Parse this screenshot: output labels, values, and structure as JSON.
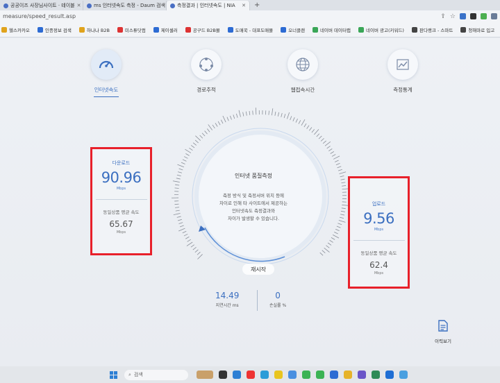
{
  "browser": {
    "tabs": [
      {
        "title": "공공이즈 사장님사이트 · 테이블",
        "active": false
      },
      {
        "title": "ms 인터넷속도 측정 - Daum 검색",
        "active": false
      },
      {
        "title": "측정결과 | 인터넷속도 | NIA",
        "active": true
      }
    ],
    "new_tab": "+",
    "url": "measure/speed_result.asp",
    "bookmarks": [
      "헬스카카오",
      "인증정보 검색",
      "하나나 B2B",
      "미스튜닷컴",
      "제이셀러",
      "공구드 B2B몰",
      "도매꾹 - 대표도매몰",
      "오너클랜",
      "네이버 데이터랩",
      "네이버 광고(키워드)",
      "판다랭크 - 스마트",
      "청해마로 입고"
    ]
  },
  "nav": {
    "items": [
      {
        "label": "인터넷속도",
        "icon": "speedometer-icon",
        "active": true
      },
      {
        "label": "경로추적",
        "icon": "route-icon",
        "active": false
      },
      {
        "label": "웹접속시간",
        "icon": "web-globe-icon",
        "active": false
      },
      {
        "label": "측정통계",
        "icon": "statistics-icon",
        "active": false
      }
    ]
  },
  "download": {
    "title": "다운로드",
    "value": "90.96",
    "unit": "Mbps",
    "avg_title": "동일상품 평균 속도",
    "avg_value": "65.67",
    "avg_unit": "Mbps"
  },
  "upload": {
    "title": "업로드",
    "value": "9.56",
    "unit": "Mbps",
    "avg_title": "동일상품 평균 속도",
    "avg_value": "62.4",
    "avg_unit": "Mbps"
  },
  "center": {
    "title": "인터넷 품질측정",
    "desc_line1": "측정 방식 및 측정서버 위치 등에",
    "desc_line2": "차이로 인해 타 사이트에서 제공하는",
    "desc_line3": "인터넷속도 측정결과와",
    "desc_line4": "차이가 발생할 수 있습니다.",
    "retry_label": "재시작"
  },
  "latency": {
    "value": "14.49",
    "label": "지연시간",
    "unit": "ms"
  },
  "loss": {
    "value": "0",
    "label": "손실률",
    "unit": "%"
  },
  "history": {
    "label": "이력보기"
  },
  "taskbar": {
    "search_placeholder": "검색"
  },
  "colors": {
    "accent": "#3b6fc0",
    "highlight_box": "#e8202a"
  }
}
